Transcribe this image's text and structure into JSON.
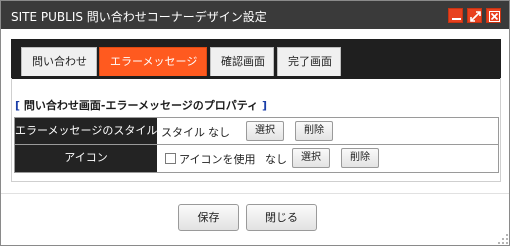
{
  "window": {
    "title": "SITE PUBLIS 問い合わせコーナーデザイン設定",
    "accent_color": "#ff5a1f",
    "titlebar_buttons": [
      "minimize-icon",
      "maximize-icon",
      "close-icon"
    ]
  },
  "tabs": [
    {
      "label": "問い合わせ",
      "active": false
    },
    {
      "label": "エラーメッセージ",
      "active": true
    },
    {
      "label": "確認画面",
      "active": false
    },
    {
      "label": "完了画面",
      "active": false
    }
  ],
  "section": {
    "title": "問い合わせ画面-エラーメッセージのプロパティ",
    "bracket_open": "[",
    "bracket_close": "]"
  },
  "properties": [
    {
      "label": "エラーメッセージのスタイル",
      "value_prefix": "スタイル",
      "value": "なし",
      "select_label": "選択",
      "delete_label": "削除"
    },
    {
      "label": "アイコン",
      "checkbox_label": "アイコンを使用",
      "checked": false,
      "value": "なし",
      "select_label": "選択",
      "delete_label": "削除"
    }
  ],
  "footer": {
    "save_label": "保存",
    "close_label": "閉じる"
  }
}
